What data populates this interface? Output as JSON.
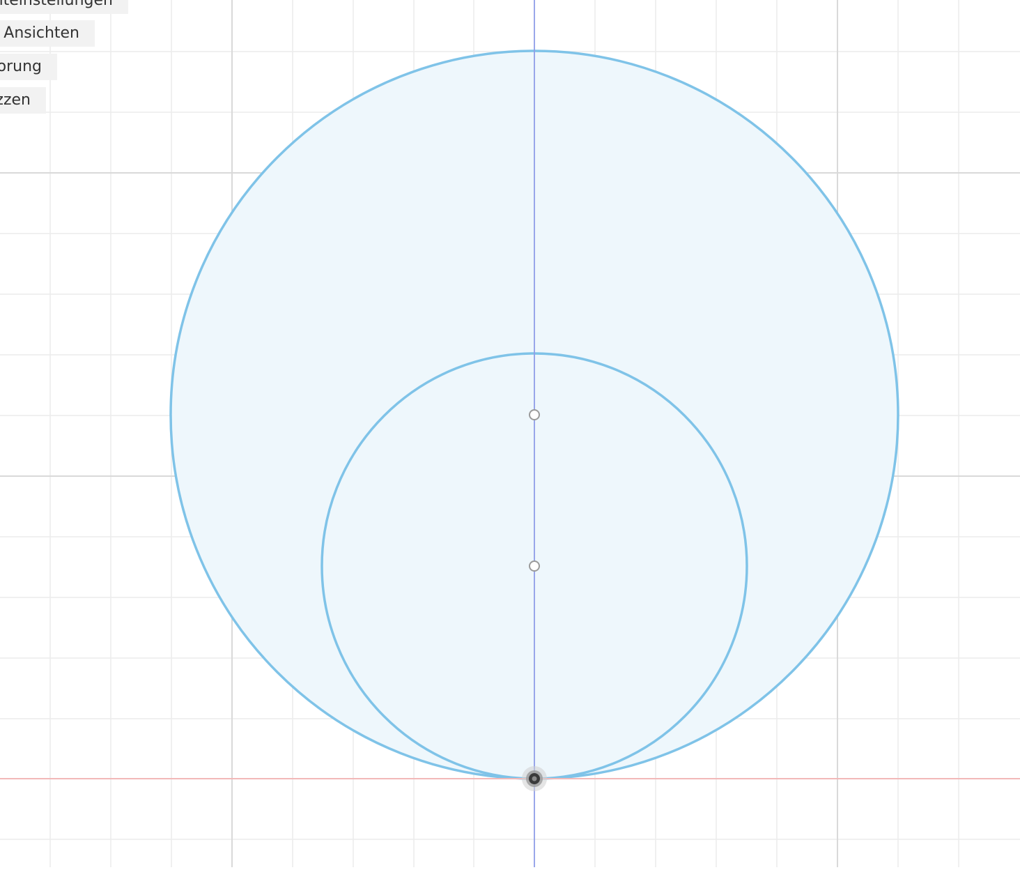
{
  "browser": {
    "items": [
      {
        "label": "nteinstellungen"
      },
      {
        "label": "e Ansichten"
      },
      {
        "label": "orung"
      },
      {
        "label": "zzen"
      }
    ]
  },
  "colors": {
    "canvas_background": "#ffffff",
    "grid_minor": "#ececec",
    "grid_major": "#d9d9d9",
    "axis_vertical": "#8f9de8",
    "axis_horizontal": "#f2b8b8",
    "sketch_stroke": "#7fc3e8",
    "profile_fill": "#eef7fc",
    "point_stroke": "#9a9a9a",
    "origin_fill": "#3a3a3a",
    "panel_background": "#f2f2f2",
    "panel_text": "#333333"
  },
  "icons": {
    "origin": "origin-point-icon",
    "sketch_point": "sketch-point-icon"
  }
}
